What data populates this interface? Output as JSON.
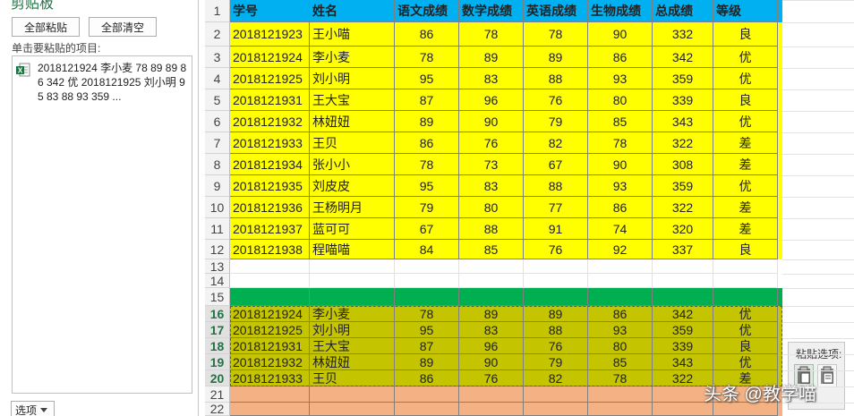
{
  "clipboard": {
    "title": "剪贴板",
    "paste_all": "全部粘贴",
    "clear_all": "全部清空",
    "hint": "单击要粘贴的项目:",
    "item_text": "2018121924 李小麦 78 89 89 86 342 优 2018121925 刘小明 95 83 88 93 359 ...",
    "options": "选项"
  },
  "sheet": {
    "headers": [
      "学号",
      "姓名",
      "语文成绩",
      "数学成绩",
      "英语成绩",
      "生物成绩",
      "总成绩",
      "等级"
    ],
    "row_numbers": [
      "1",
      "2",
      "3",
      "4",
      "5",
      "6",
      "7",
      "8",
      "9",
      "10",
      "11",
      "12",
      "13",
      "14",
      "15",
      "16",
      "17",
      "18",
      "19",
      "20",
      "21",
      "22"
    ],
    "main_rows": [
      [
        "2018121923",
        "王小喵",
        "86",
        "78",
        "78",
        "90",
        "332",
        "良"
      ],
      [
        "2018121924",
        "李小麦",
        "78",
        "89",
        "89",
        "86",
        "342",
        "优"
      ],
      [
        "2018121925",
        "刘小明",
        "95",
        "83",
        "88",
        "93",
        "359",
        "优"
      ],
      [
        "2018121931",
        "王大宝",
        "87",
        "96",
        "76",
        "80",
        "339",
        "良"
      ],
      [
        "2018121932",
        "林妞妞",
        "89",
        "90",
        "79",
        "85",
        "343",
        "优"
      ],
      [
        "2018121933",
        "王贝",
        "86",
        "76",
        "82",
        "78",
        "322",
        "差"
      ],
      [
        "2018121934",
        "张小小",
        "78",
        "73",
        "67",
        "90",
        "308",
        "差"
      ],
      [
        "2018121935",
        "刘皮皮",
        "95",
        "83",
        "88",
        "93",
        "359",
        "优"
      ],
      [
        "2018121936",
        "王杨明月",
        "79",
        "80",
        "77",
        "86",
        "322",
        "差"
      ],
      [
        "2018121937",
        "蓝可可",
        "67",
        "88",
        "91",
        "74",
        "320",
        "差"
      ],
      [
        "2018121938",
        "程喵喵",
        "84",
        "85",
        "76",
        "92",
        "337",
        "良"
      ]
    ],
    "pasted_rows": [
      [
        "2018121924",
        "李小麦",
        "78",
        "89",
        "89",
        "86",
        "342",
        "优"
      ],
      [
        "2018121925",
        "刘小明",
        "95",
        "83",
        "88",
        "93",
        "359",
        "优"
      ],
      [
        "2018121931",
        "王大宝",
        "87",
        "96",
        "76",
        "80",
        "339",
        "良"
      ],
      [
        "2018121932",
        "林妞妞",
        "89",
        "90",
        "79",
        "85",
        "343",
        "优"
      ],
      [
        "2018121933",
        "王贝",
        "86",
        "76",
        "82",
        "78",
        "322",
        "差"
      ]
    ],
    "colors": {
      "header_blue": "#00b0f0",
      "data_yellow": "#ffff00",
      "green_band": "#00b050",
      "pasted_olive": "#c4c400",
      "orange_band": "#f4b183"
    }
  },
  "paste_options": {
    "label": "粘贴选项:"
  },
  "watermark": "头条 @教学喵"
}
